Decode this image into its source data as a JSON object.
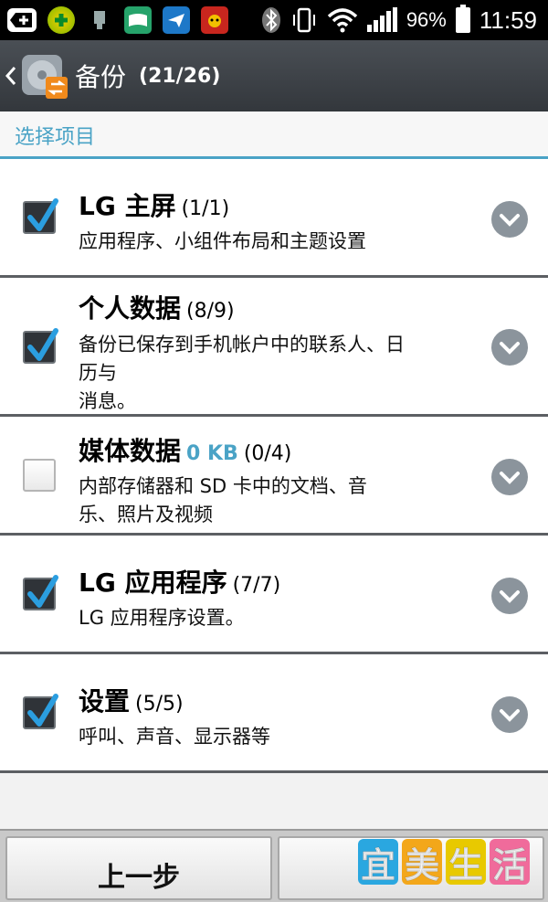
{
  "status_bar": {
    "battery": "96%",
    "time": "11:59",
    "icons_left": [
      "add-icon",
      "app-icon-green",
      "usb-icon",
      "app-icon-book",
      "bird-icon",
      "app-icon-red"
    ],
    "icons_right": [
      "bluetooth-icon",
      "vibrate-icon",
      "wifi-icon",
      "signal-icon",
      "battery-icon"
    ]
  },
  "action_bar": {
    "title": "备份",
    "count": "(21/26)"
  },
  "section": {
    "header": "选择项目"
  },
  "items": [
    {
      "title": "LG 主屏",
      "count": "(1/1)",
      "description": "应用程序、小组件布局和主题设置",
      "checked": true
    },
    {
      "title": "个人数据",
      "count": "(8/9)",
      "description_lines": [
        "备份已保存到手机帐户中的联系人、日",
        "历与",
        "消息。"
      ],
      "checked": true
    },
    {
      "title": "媒体数据",
      "size": "0 KB",
      "count": "(0/4)",
      "description_lines": [
        "内部存储器和 SD 卡中的文档、音",
        "乐、照片及视频"
      ],
      "checked": false
    },
    {
      "title": "LG 应用程序",
      "count": "(7/7)",
      "description": "LG 应用程序设置。",
      "checked": true
    },
    {
      "title": "设置",
      "count": "(5/5)",
      "description": "呼叫、声音、显示器等",
      "checked": true
    }
  ],
  "bottom_bar": {
    "prev_label": "上一步",
    "watermark": [
      "宜",
      "美",
      "生",
      "活"
    ]
  },
  "colors": {
    "accent": "#4aa3c6",
    "actionbar": "#3d4247",
    "divider": "#5c5f63",
    "expand_button": "#8b949c"
  }
}
